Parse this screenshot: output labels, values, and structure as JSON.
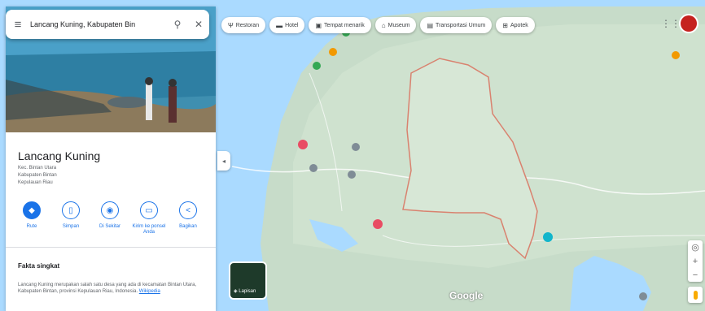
{
  "search": {
    "query": "Lancang Kuning, Kabupaten Bin",
    "menu_icon": "menu-icon",
    "search_icon": "search-icon",
    "close_icon": "close-icon"
  },
  "place": {
    "title": "Lancang Kuning",
    "address_lines": [
      "Kec. Bintan Utara",
      "Kabupaten Bintan",
      "Kepulauan Riau"
    ]
  },
  "actions": [
    {
      "label": "Rute",
      "icon": "directions-icon",
      "filled": true
    },
    {
      "label": "Simpan",
      "icon": "save-icon",
      "filled": false
    },
    {
      "label": "Di Sekitar",
      "icon": "nearby-icon",
      "filled": false
    },
    {
      "label": "Kirim ke ponsel Anda",
      "icon": "phone-icon",
      "filled": false
    },
    {
      "label": "Bagikan",
      "icon": "share-icon",
      "filled": false
    }
  ],
  "facts": {
    "heading": "Fakta singkat",
    "text": "Lancang Kuning merupakan salah satu desa yang ada di kecamatan Bintan Utara, Kabupaten Bintan, provinsi Kepulauan Riau, Indonesia.",
    "more_link": "Wikipedia"
  },
  "chips": [
    {
      "label": "Restoran",
      "icon": "restaurant-icon"
    },
    {
      "label": "Hotel",
      "icon": "hotel-icon"
    },
    {
      "label": "Tempat menarik",
      "icon": "attraction-icon"
    },
    {
      "label": "Museum",
      "icon": "museum-icon"
    },
    {
      "label": "Transportasi Umum",
      "icon": "transit-icon"
    },
    {
      "label": "Apotek",
      "icon": "pharmacy-icon"
    }
  ],
  "layers": {
    "label": "Lapisan"
  },
  "map_labels": [],
  "footer": [],
  "colors": {
    "accent": "#1a73e8",
    "boundary": "#d9826f",
    "water": "#aadaff",
    "land": "#c6dcc8"
  }
}
